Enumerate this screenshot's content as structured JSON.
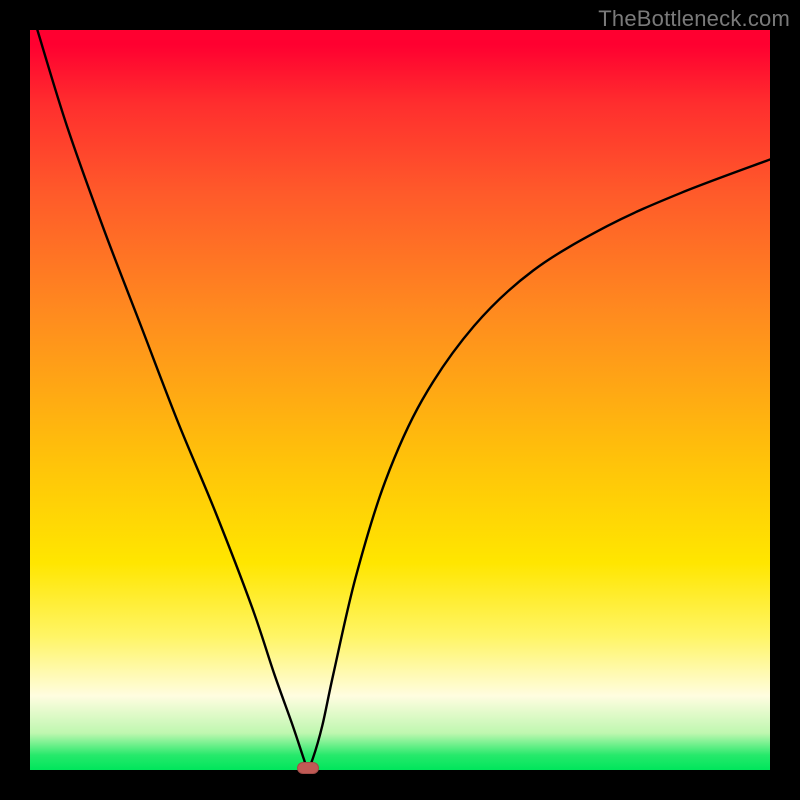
{
  "watermark": "TheBottleneck.com",
  "marker": {
    "x_pct": 37.5,
    "y_pct": 0
  },
  "gradient": {
    "top": "#ff0030",
    "mid": "#ffe600",
    "bottom": "#00e65c"
  },
  "chart_data": {
    "type": "line",
    "title": "",
    "xlabel": "",
    "ylabel": "",
    "xlim_pct": [
      0,
      100
    ],
    "ylim_pct": [
      0,
      100
    ],
    "series": [
      {
        "name": "curve",
        "x_pct": [
          1.0,
          5.0,
          10.0,
          15.0,
          20.0,
          25.0,
          30.0,
          33.0,
          35.5,
          37.0,
          37.5,
          38.2,
          39.5,
          41.0,
          44.0,
          48.0,
          53.0,
          60.0,
          68.0,
          78.0,
          88.0,
          100.0
        ],
        "y_pct": [
          100.0,
          87.0,
          73.0,
          60.0,
          47.0,
          35.0,
          22.0,
          13.0,
          6.0,
          1.5,
          0.2,
          1.5,
          6.0,
          13.0,
          26.0,
          39.0,
          50.0,
          60.0,
          67.5,
          73.5,
          78.0,
          82.5
        ]
      }
    ],
    "notes": "x_pct and y_pct are percentages of a 740×740 plot; y_pct=0 is plot bottom (green), y_pct=100 is plot top (red). Values estimated from rendered pixels."
  }
}
